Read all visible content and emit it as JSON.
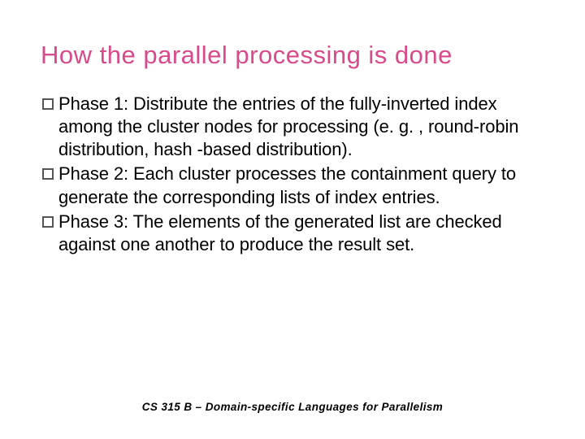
{
  "title": "How the parallel processing is done",
  "bullets": [
    "Phase 1: Distribute the entries of the fully-inverted index among the cluster nodes for processing (e. g. , round-robin distribution,   hash -based distribution).",
    "Phase 2: Each cluster processes the containment query to generate the corresponding lists of index entries.",
    "Phase 3: The elements of the generated list are checked against one another to produce the result set."
  ],
  "footer": "CS 315 B – Domain-specific Languages for Parallelism"
}
